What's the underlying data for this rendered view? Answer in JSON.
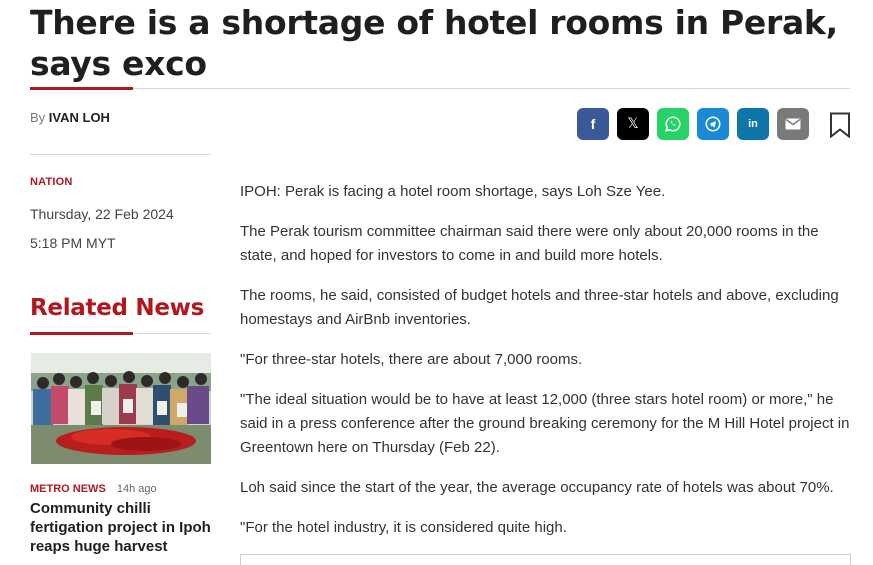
{
  "article": {
    "headline": "There is a shortage of hotel rooms in Perak, says exco",
    "byline_prefix": "By",
    "author": "IVAN LOH",
    "category": "NATION",
    "date": "Thursday, 22 Feb 2024",
    "time": "5:18 PM MYT",
    "paragraphs": [
      "IPOH: Perak is facing a hotel room shortage, says Loh Sze Yee.",
      "The Perak tourism committee chairman said there were only about 20,000 rooms in the state, and hoped for investors to come in and build more hotels.",
      "The rooms, he said, consisted of budget hotels and three-star hotels and above, excluding homestays and AirBnb inventories.",
      "\"For three-star hotels, there are about 7,000 rooms.",
      "\"The ideal situation would be to have at least 12,000 (three stars hotel room) or more,\" he said in a press conference after the ground breaking ceremony for the M Hill Hotel project in Greentown here on Thursday (Feb 22).",
      "Loh said since the start of the year, the average occupancy rate of hotels was about 70%.",
      "\"For the hotel industry, it is considered quite high."
    ]
  },
  "share": {
    "buttons": [
      {
        "name": "facebook",
        "icon": "facebook-icon",
        "glyph": "f",
        "color": "#3b5998"
      },
      {
        "name": "x",
        "icon": "x-icon",
        "glyph": "𝕏",
        "color": "#000000"
      },
      {
        "name": "whatsapp",
        "icon": "whatsapp-icon",
        "color": "#25d366"
      },
      {
        "name": "telegram",
        "icon": "telegram-icon",
        "color": "#1a8ad5"
      },
      {
        "name": "linkedin",
        "icon": "linkedin-icon",
        "glyph": "in",
        "color": "#0e76a8"
      },
      {
        "name": "email",
        "icon": "email-icon",
        "color": "#7a7a7a"
      }
    ],
    "bookmark_icon": "bookmark-icon"
  },
  "related": {
    "section_title": "Related News",
    "items": [
      {
        "category": "METRO NEWS",
        "age": "14h ago",
        "headline": "Community chilli fertigation project in Ipoh reaps huge harvest"
      }
    ]
  },
  "colors": {
    "accent": "#b3171e",
    "text": "#333333",
    "headline": "#1f1f1f"
  }
}
